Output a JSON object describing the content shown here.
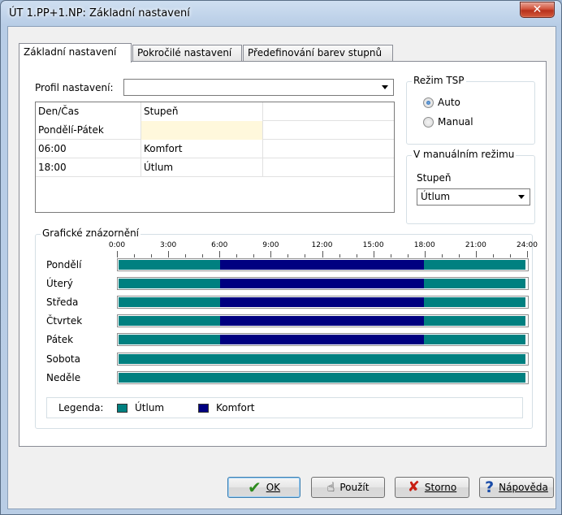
{
  "window": {
    "title": "ÚT 1.PP+1.NP: Základní nastavení",
    "close_glyph": "✕"
  },
  "tabs": [
    {
      "label": "Základní nastavení",
      "active": true
    },
    {
      "label": "Pokročilé nastavení",
      "active": false
    },
    {
      "label": "Předefinování barev stupnů",
      "active": false
    }
  ],
  "profile": {
    "label": "Profil nastavení:",
    "value": ""
  },
  "table": {
    "headers": [
      "Den/Čas",
      "Stupeň"
    ],
    "rows": [
      [
        "Pondělí-Pátek",
        ""
      ],
      [
        "06:00",
        "Komfort"
      ],
      [
        "18:00",
        "Útlum"
      ]
    ]
  },
  "tsp_mode": {
    "title": "Režim TSP",
    "options": [
      {
        "label": "Auto",
        "checked": true
      },
      {
        "label": "Manual",
        "checked": false
      }
    ]
  },
  "manual_mode": {
    "title": "V manuálním režimu",
    "stage_label": "Stupeň",
    "stage_value": "Útlum"
  },
  "graph": {
    "title": "Grafické znázornění",
    "time_labels": [
      "0:00",
      "3:00",
      "6:00",
      "9:00",
      "12:00",
      "15:00",
      "18:00",
      "21:00",
      "24:00"
    ],
    "days": [
      {
        "label": "Pondělí",
        "segments": [
          {
            "from": 0,
            "to": 6,
            "stage": "Útlum"
          },
          {
            "from": 6,
            "to": 18,
            "stage": "Komfort"
          },
          {
            "from": 18,
            "to": 24,
            "stage": "Útlum"
          }
        ]
      },
      {
        "label": "Úterý",
        "segments": [
          {
            "from": 0,
            "to": 6,
            "stage": "Útlum"
          },
          {
            "from": 6,
            "to": 18,
            "stage": "Komfort"
          },
          {
            "from": 18,
            "to": 24,
            "stage": "Útlum"
          }
        ]
      },
      {
        "label": "Středa",
        "segments": [
          {
            "from": 0,
            "to": 6,
            "stage": "Útlum"
          },
          {
            "from": 6,
            "to": 18,
            "stage": "Komfort"
          },
          {
            "from": 18,
            "to": 24,
            "stage": "Útlum"
          }
        ]
      },
      {
        "label": "Čtvrtek",
        "segments": [
          {
            "from": 0,
            "to": 6,
            "stage": "Útlum"
          },
          {
            "from": 6,
            "to": 18,
            "stage": "Komfort"
          },
          {
            "from": 18,
            "to": 24,
            "stage": "Útlum"
          }
        ]
      },
      {
        "label": "Pátek",
        "segments": [
          {
            "from": 0,
            "to": 6,
            "stage": "Útlum"
          },
          {
            "from": 6,
            "to": 18,
            "stage": "Komfort"
          },
          {
            "from": 18,
            "to": 24,
            "stage": "Útlum"
          }
        ]
      },
      {
        "label": "Sobota",
        "segments": [
          {
            "from": 0,
            "to": 24,
            "stage": "Útlum"
          }
        ]
      },
      {
        "label": "Neděle",
        "segments": [
          {
            "from": 0,
            "to": 24,
            "stage": "Útlum"
          }
        ]
      }
    ],
    "legend": {
      "label": "Legenda:",
      "items": [
        {
          "label": "Útlum",
          "color": "#008080"
        },
        {
          "label": "Komfort",
          "color": "#000080"
        }
      ]
    }
  },
  "buttons": {
    "ok": {
      "label": "OK",
      "icon": "checkmark-icon"
    },
    "apply": {
      "label": "Použít",
      "icon": "hand-icon"
    },
    "cancel": {
      "label": "Storno",
      "icon": "x-icon"
    },
    "help": {
      "label": "Nápověda",
      "icon": "help-icon"
    }
  }
}
